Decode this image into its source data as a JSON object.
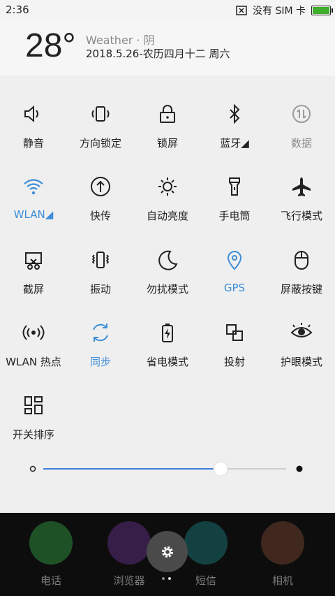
{
  "status_bar": {
    "time": "2:36",
    "no_sim": "没有 SIM 卡"
  },
  "weather": {
    "temperature": "28°",
    "condition": "Weather · 阴",
    "date_line": "2018.5.26-农历四月十二 周六"
  },
  "tiles": [
    {
      "label": "静音",
      "icon": "speaker-icon",
      "state": "off"
    },
    {
      "label": "方向锁定",
      "icon": "rotation-lock-icon",
      "state": "off"
    },
    {
      "label": "锁屏",
      "icon": "lock-icon",
      "state": "off"
    },
    {
      "label": "蓝牙◢",
      "icon": "bluetooth-icon",
      "state": "off"
    },
    {
      "label": "数据",
      "icon": "mobile-data-icon",
      "state": "disabled"
    },
    {
      "label": "WLAN◢",
      "icon": "wifi-icon",
      "state": "on"
    },
    {
      "label": "快传",
      "icon": "quick-share-icon",
      "state": "off"
    },
    {
      "label": "自动亮度",
      "icon": "brightness-icon",
      "state": "off"
    },
    {
      "label": "手电筒",
      "icon": "flashlight-icon",
      "state": "off"
    },
    {
      "label": "飞行模式",
      "icon": "airplane-icon",
      "state": "off"
    },
    {
      "label": "截屏",
      "icon": "screenshot-icon",
      "state": "off"
    },
    {
      "label": "振动",
      "icon": "vibration-icon",
      "state": "off"
    },
    {
      "label": "勿扰模式",
      "icon": "moon-icon",
      "state": "off"
    },
    {
      "label": "GPS",
      "icon": "location-pin-icon",
      "state": "on"
    },
    {
      "label": "屏蔽按键",
      "icon": "mouse-icon",
      "state": "off"
    },
    {
      "label": "WLAN 热点",
      "icon": "hotspot-icon",
      "state": "off"
    },
    {
      "label": "同步",
      "icon": "sync-icon",
      "state": "on"
    },
    {
      "label": "省电模式",
      "icon": "battery-saver-icon",
      "state": "off"
    },
    {
      "label": "投射",
      "icon": "cast-icon",
      "state": "off"
    },
    {
      "label": "护眼模式",
      "icon": "eye-icon",
      "state": "off"
    },
    {
      "label": "开关排序",
      "icon": "grid-sort-icon",
      "state": "off"
    }
  ],
  "brightness": {
    "level": 0.73
  },
  "dock": [
    {
      "label": "电话",
      "color": "#2e8b3c"
    },
    {
      "label": "浏览器",
      "color": "#5a2e7a"
    },
    {
      "label": "短信",
      "color": "#1a6e70"
    },
    {
      "label": "相机",
      "color": "#6b4030"
    }
  ],
  "page_indicator": {
    "pages": 2,
    "current": 1
  },
  "colors": {
    "accent": "#3d8ed8",
    "panel": "#efefef"
  }
}
